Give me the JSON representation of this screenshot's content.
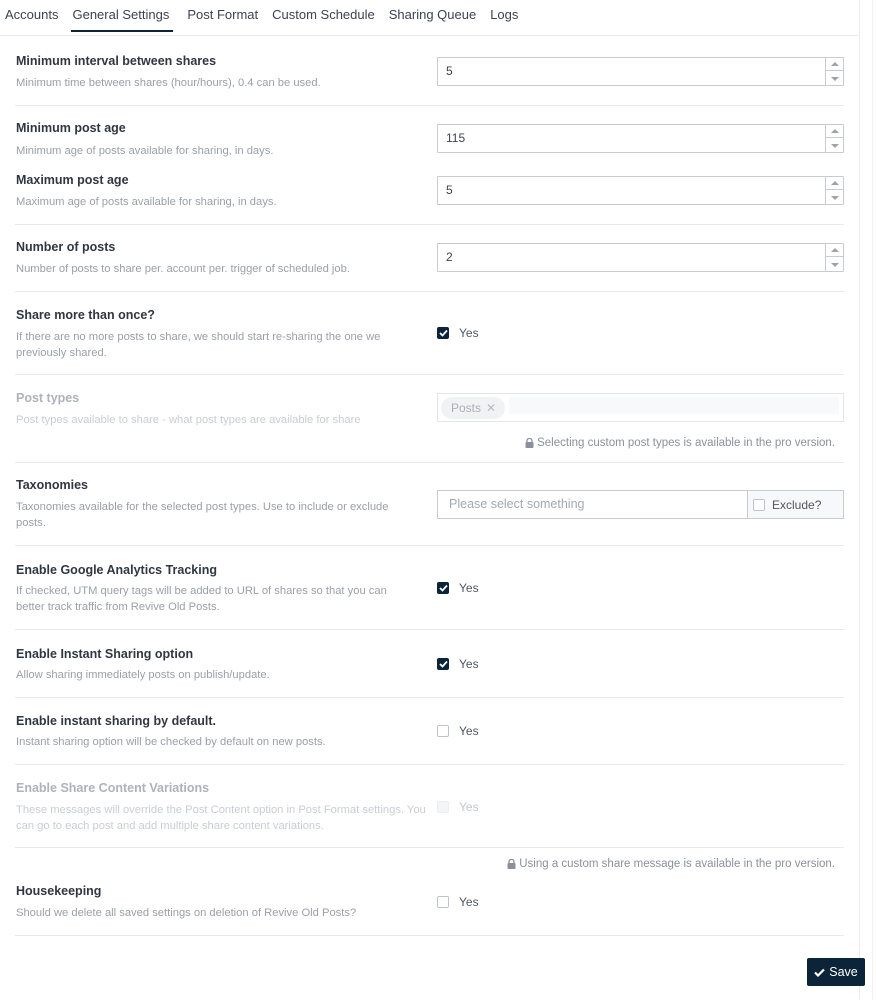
{
  "tabs": [
    {
      "label": "Accounts",
      "active": false
    },
    {
      "label": "General Settings",
      "active": true
    },
    {
      "label": "Post Format",
      "active": false
    },
    {
      "label": "Custom Schedule",
      "active": false
    },
    {
      "label": "Sharing Queue",
      "active": false
    },
    {
      "label": "Logs",
      "active": false
    }
  ],
  "settings": {
    "min_interval": {
      "label": "Minimum interval between shares",
      "description": "Minimum time between shares (hour/hours), 0.4 can be used.",
      "value": "5"
    },
    "min_post_age": {
      "label": "Minimum post age",
      "description": "Minimum age of posts available for sharing, in days.",
      "value": "115"
    },
    "max_post_age": {
      "label": "Maximum post age",
      "description": "Maximum age of posts available for sharing, in days.",
      "value": "5"
    },
    "number_of_posts": {
      "label": "Number of posts",
      "description": "Number of posts to share per. account per. trigger of scheduled job.",
      "value": "2"
    },
    "share_more_than_once": {
      "label": "Share more than once?",
      "description": "If there are no more posts to share, we should start re-sharing the one we previously shared.",
      "checkbox_label": "Yes",
      "checked": true
    },
    "post_types": {
      "label": "Post types",
      "description": "Post types available to share - what post types are available for share",
      "tags": [
        "Posts"
      ],
      "pro_note": "Selecting custom post types is available in the pro version.",
      "disabled": true
    },
    "taxonomies": {
      "label": "Taxonomies",
      "description": "Taxonomies available for the selected post types. Use to include or exclude posts.",
      "placeholder": "Please select something",
      "exclude_label": "Exclude?",
      "exclude_checked": false
    },
    "ga_tracking": {
      "label": "Enable Google Analytics Tracking",
      "description": "If checked, UTM query tags will be added to URL of shares so that you can better track traffic from Revive Old Posts.",
      "checkbox_label": "Yes",
      "checked": true
    },
    "instant_sharing": {
      "label": "Enable Instant Sharing option",
      "description": "Allow sharing immediately posts on publish/update.",
      "checkbox_label": "Yes",
      "checked": true
    },
    "instant_sharing_default": {
      "label": "Enable instant sharing by default.",
      "description": "Instant sharing option will be checked by default on new posts.",
      "checkbox_label": "Yes",
      "checked": false
    },
    "content_variations": {
      "label": "Enable Share Content Variations",
      "description": "These messages will override the Post Content option in Post Format settings. You can go to each post and add multiple share content variations.",
      "checkbox_label": "Yes",
      "checked": false,
      "disabled": true,
      "pro_note": "Using a custom share message is available in the pro version."
    },
    "housekeeping": {
      "label": "Housekeeping",
      "description": "Should we delete all saved settings on deletion of Revive Old Posts?",
      "checkbox_label": "Yes",
      "checked": false
    }
  },
  "actions": {
    "save_label": "Save"
  },
  "colors": {
    "accent": "#0b2439",
    "label": "#303742",
    "description": "#9aa0aa",
    "border": "#c8ccd2"
  }
}
